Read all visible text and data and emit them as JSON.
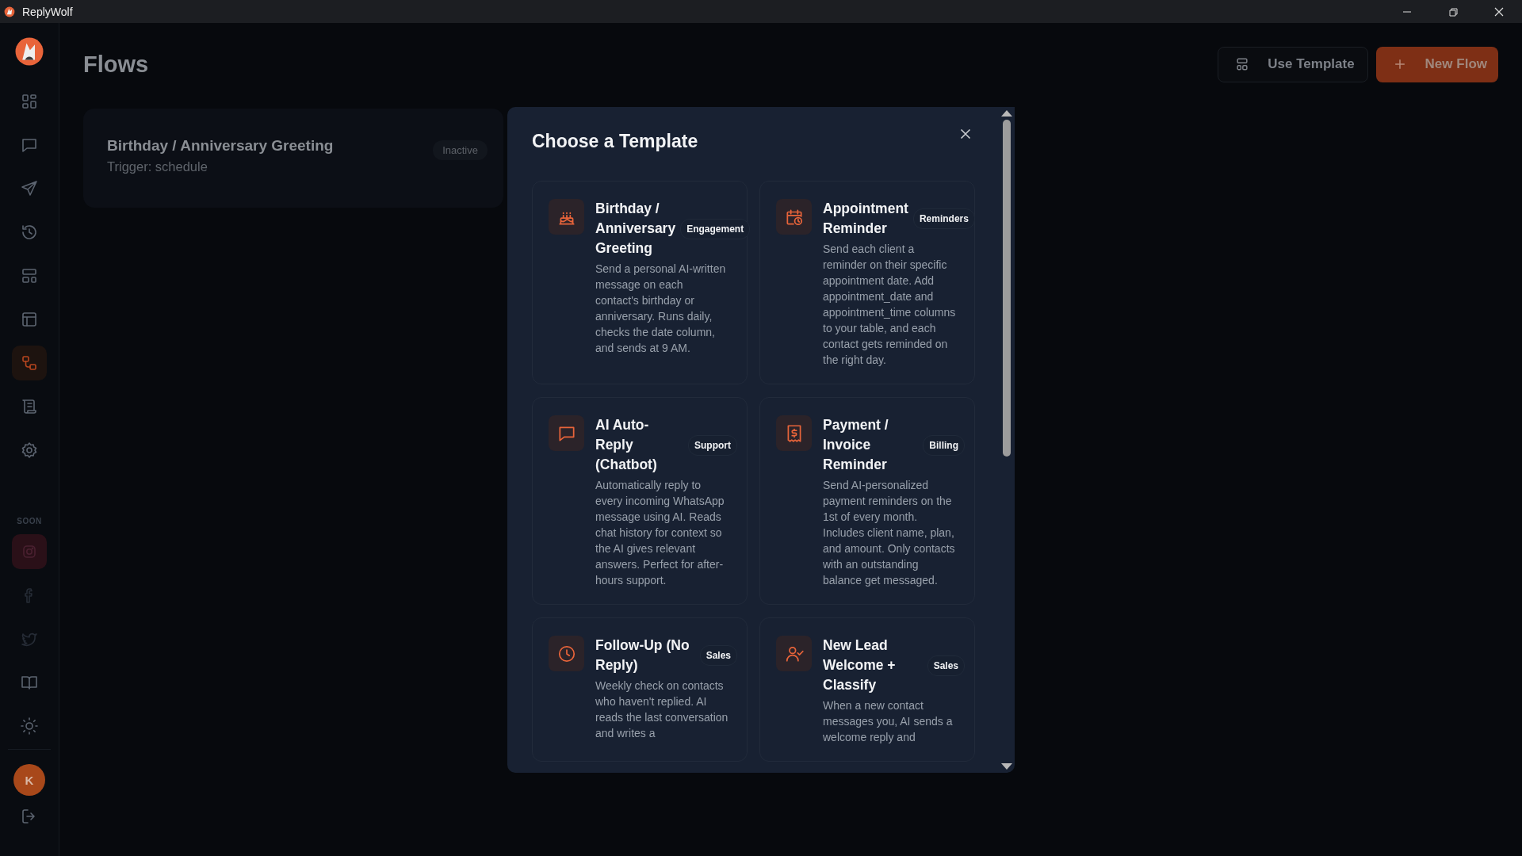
{
  "window": {
    "title": "ReplyWolf"
  },
  "sidebar": {
    "items": [
      {
        "selected": false
      },
      {
        "selected": false
      },
      {
        "selected": false
      },
      {
        "selected": false
      },
      {
        "selected": false
      },
      {
        "selected": false
      },
      {
        "selected": true
      },
      {
        "selected": false
      },
      {
        "selected": false
      }
    ],
    "soon_label": "SOON",
    "soon_items": [
      {
        "disabled": true
      },
      {
        "disabled": true
      },
      {
        "disabled": true
      }
    ],
    "avatar": "K"
  },
  "header": {
    "title": "Flows",
    "buttons": [
      {
        "label": "Use Template",
        "kind": "secondary"
      },
      {
        "label": "New Flow",
        "kind": "primary"
      }
    ]
  },
  "flows": [
    {
      "name": "Birthday / Anniversary Greeting",
      "trigger": "Trigger: schedule",
      "status": "Inactive",
      "active": false
    }
  ],
  "modal": {
    "title": "Choose a Template",
    "templates": [
      {
        "title": "Birthday / Anniversary Greeting",
        "tag": "Engagement",
        "description": "Send a personal AI-written message on each contact's birthday or anniversary. Runs daily, checks the date column, and sends at 9 AM."
      },
      {
        "title": "Appointment Reminder",
        "tag": "Reminders",
        "description": "Send each client a reminder on their specific appointment date. Add appointment_date and appointment_time columns to your table, and each contact gets reminded on the right day."
      },
      {
        "title": "AI Auto-Reply (Chatbot)",
        "tag": "Support",
        "description": "Automatically reply to every incoming WhatsApp message using AI. Reads chat history for context so the AI gives relevant answers. Perfect for after-hours support."
      },
      {
        "title": "Payment / Invoice Reminder",
        "tag": "Billing",
        "description": "Send AI-personalized payment reminders on the 1st of every month. Includes client name, plan, and amount. Only contacts with an outstanding balance get messaged."
      },
      {
        "title": "Follow-Up (No Reply)",
        "tag": "Sales",
        "description": "Weekly check on contacts who haven't replied. AI reads the last conversation and writes a"
      },
      {
        "title": "New Lead Welcome + Classify",
        "tag": "Sales",
        "description": "When a new contact messages you, AI sends a welcome reply and"
      }
    ]
  }
}
